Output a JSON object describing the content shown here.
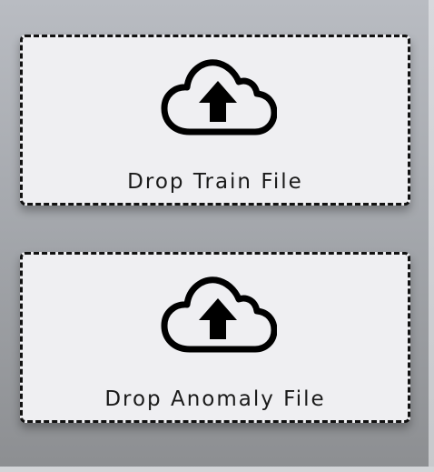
{
  "drop_zones": [
    {
      "label": "Drop Train File",
      "icon": "cloud-upload-icon"
    },
    {
      "label": "Drop Anomaly File",
      "icon": "cloud-upload-icon"
    }
  ]
}
